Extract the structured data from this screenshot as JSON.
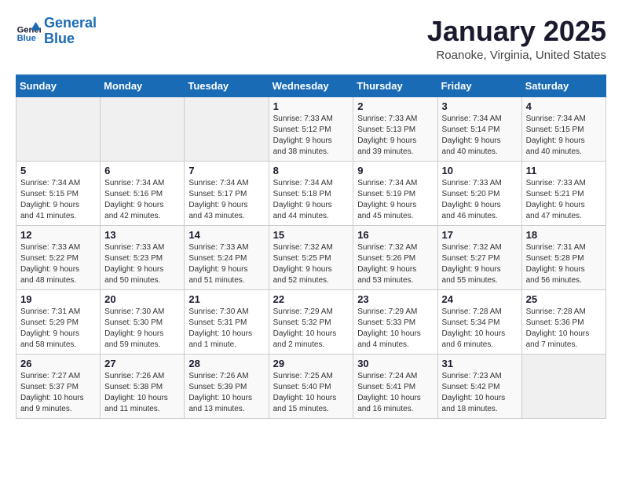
{
  "header": {
    "logo_line1": "General",
    "logo_line2": "Blue",
    "calendar_title": "January 2025",
    "calendar_subtitle": "Roanoke, Virginia, United States"
  },
  "weekdays": [
    "Sunday",
    "Monday",
    "Tuesday",
    "Wednesday",
    "Thursday",
    "Friday",
    "Saturday"
  ],
  "weeks": [
    [
      {
        "day": "",
        "info": ""
      },
      {
        "day": "",
        "info": ""
      },
      {
        "day": "",
        "info": ""
      },
      {
        "day": "1",
        "info": "Sunrise: 7:33 AM\nSunset: 5:12 PM\nDaylight: 9 hours\nand 38 minutes."
      },
      {
        "day": "2",
        "info": "Sunrise: 7:33 AM\nSunset: 5:13 PM\nDaylight: 9 hours\nand 39 minutes."
      },
      {
        "day": "3",
        "info": "Sunrise: 7:34 AM\nSunset: 5:14 PM\nDaylight: 9 hours\nand 40 minutes."
      },
      {
        "day": "4",
        "info": "Sunrise: 7:34 AM\nSunset: 5:15 PM\nDaylight: 9 hours\nand 40 minutes."
      }
    ],
    [
      {
        "day": "5",
        "info": "Sunrise: 7:34 AM\nSunset: 5:15 PM\nDaylight: 9 hours\nand 41 minutes."
      },
      {
        "day": "6",
        "info": "Sunrise: 7:34 AM\nSunset: 5:16 PM\nDaylight: 9 hours\nand 42 minutes."
      },
      {
        "day": "7",
        "info": "Sunrise: 7:34 AM\nSunset: 5:17 PM\nDaylight: 9 hours\nand 43 minutes."
      },
      {
        "day": "8",
        "info": "Sunrise: 7:34 AM\nSunset: 5:18 PM\nDaylight: 9 hours\nand 44 minutes."
      },
      {
        "day": "9",
        "info": "Sunrise: 7:34 AM\nSunset: 5:19 PM\nDaylight: 9 hours\nand 45 minutes."
      },
      {
        "day": "10",
        "info": "Sunrise: 7:33 AM\nSunset: 5:20 PM\nDaylight: 9 hours\nand 46 minutes."
      },
      {
        "day": "11",
        "info": "Sunrise: 7:33 AM\nSunset: 5:21 PM\nDaylight: 9 hours\nand 47 minutes."
      }
    ],
    [
      {
        "day": "12",
        "info": "Sunrise: 7:33 AM\nSunset: 5:22 PM\nDaylight: 9 hours\nand 48 minutes."
      },
      {
        "day": "13",
        "info": "Sunrise: 7:33 AM\nSunset: 5:23 PM\nDaylight: 9 hours\nand 50 minutes."
      },
      {
        "day": "14",
        "info": "Sunrise: 7:33 AM\nSunset: 5:24 PM\nDaylight: 9 hours\nand 51 minutes."
      },
      {
        "day": "15",
        "info": "Sunrise: 7:32 AM\nSunset: 5:25 PM\nDaylight: 9 hours\nand 52 minutes."
      },
      {
        "day": "16",
        "info": "Sunrise: 7:32 AM\nSunset: 5:26 PM\nDaylight: 9 hours\nand 53 minutes."
      },
      {
        "day": "17",
        "info": "Sunrise: 7:32 AM\nSunset: 5:27 PM\nDaylight: 9 hours\nand 55 minutes."
      },
      {
        "day": "18",
        "info": "Sunrise: 7:31 AM\nSunset: 5:28 PM\nDaylight: 9 hours\nand 56 minutes."
      }
    ],
    [
      {
        "day": "19",
        "info": "Sunrise: 7:31 AM\nSunset: 5:29 PM\nDaylight: 9 hours\nand 58 minutes."
      },
      {
        "day": "20",
        "info": "Sunrise: 7:30 AM\nSunset: 5:30 PM\nDaylight: 9 hours\nand 59 minutes."
      },
      {
        "day": "21",
        "info": "Sunrise: 7:30 AM\nSunset: 5:31 PM\nDaylight: 10 hours\nand 1 minute."
      },
      {
        "day": "22",
        "info": "Sunrise: 7:29 AM\nSunset: 5:32 PM\nDaylight: 10 hours\nand 2 minutes."
      },
      {
        "day": "23",
        "info": "Sunrise: 7:29 AM\nSunset: 5:33 PM\nDaylight: 10 hours\nand 4 minutes."
      },
      {
        "day": "24",
        "info": "Sunrise: 7:28 AM\nSunset: 5:34 PM\nDaylight: 10 hours\nand 6 minutes."
      },
      {
        "day": "25",
        "info": "Sunrise: 7:28 AM\nSunset: 5:36 PM\nDaylight: 10 hours\nand 7 minutes."
      }
    ],
    [
      {
        "day": "26",
        "info": "Sunrise: 7:27 AM\nSunset: 5:37 PM\nDaylight: 10 hours\nand 9 minutes."
      },
      {
        "day": "27",
        "info": "Sunrise: 7:26 AM\nSunset: 5:38 PM\nDaylight: 10 hours\nand 11 minutes."
      },
      {
        "day": "28",
        "info": "Sunrise: 7:26 AM\nSunset: 5:39 PM\nDaylight: 10 hours\nand 13 minutes."
      },
      {
        "day": "29",
        "info": "Sunrise: 7:25 AM\nSunset: 5:40 PM\nDaylight: 10 hours\nand 15 minutes."
      },
      {
        "day": "30",
        "info": "Sunrise: 7:24 AM\nSunset: 5:41 PM\nDaylight: 10 hours\nand 16 minutes."
      },
      {
        "day": "31",
        "info": "Sunrise: 7:23 AM\nSunset: 5:42 PM\nDaylight: 10 hours\nand 18 minutes."
      },
      {
        "day": "",
        "info": ""
      }
    ]
  ]
}
